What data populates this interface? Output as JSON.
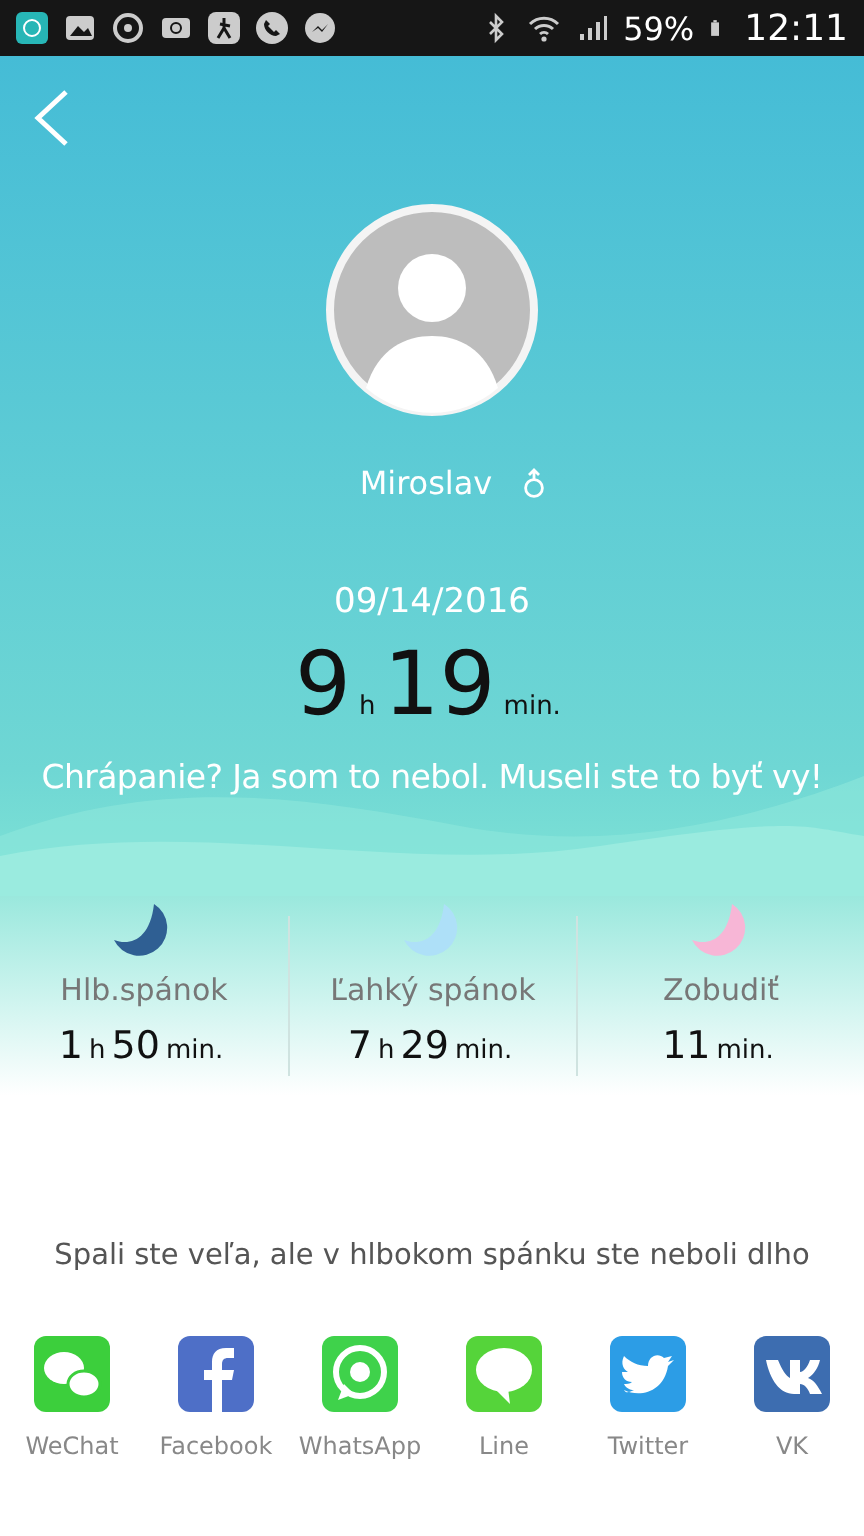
{
  "status_bar": {
    "battery": "59%",
    "time": "12:11"
  },
  "profile": {
    "name": "Miroslav"
  },
  "summary": {
    "date": "09/14/2016",
    "hours": "9",
    "hours_unit": "h",
    "minutes": "19",
    "minutes_unit": "min.",
    "message": "Chrápanie? Ja som to nebol. Museli ste to byť vy!"
  },
  "stages": [
    {
      "label": "Hlb.spánok",
      "hours": "1",
      "hours_unit": "h",
      "minutes": "50",
      "minutes_unit": "min.",
      "color": "#2f5f93"
    },
    {
      "label": "Ľahký spánok",
      "hours": "7",
      "hours_unit": "h",
      "minutes": "29",
      "minutes_unit": "min.",
      "color": "#aee0f8"
    },
    {
      "label": "Zobudiť",
      "minutes": "11",
      "minutes_unit": "min.",
      "color": "#f7b6d6"
    }
  ],
  "advice": "Spali ste veľa, ale v hlbokom spánku ste neboli dlho",
  "share": [
    {
      "kind": "wechat",
      "label": "WeChat"
    },
    {
      "kind": "facebook",
      "label": "Facebook"
    },
    {
      "kind": "whatsapp",
      "label": "WhatsApp"
    },
    {
      "kind": "line",
      "label": "Line"
    },
    {
      "kind": "twitter",
      "label": "Twitter"
    },
    {
      "kind": "vk",
      "label": "VK"
    }
  ]
}
